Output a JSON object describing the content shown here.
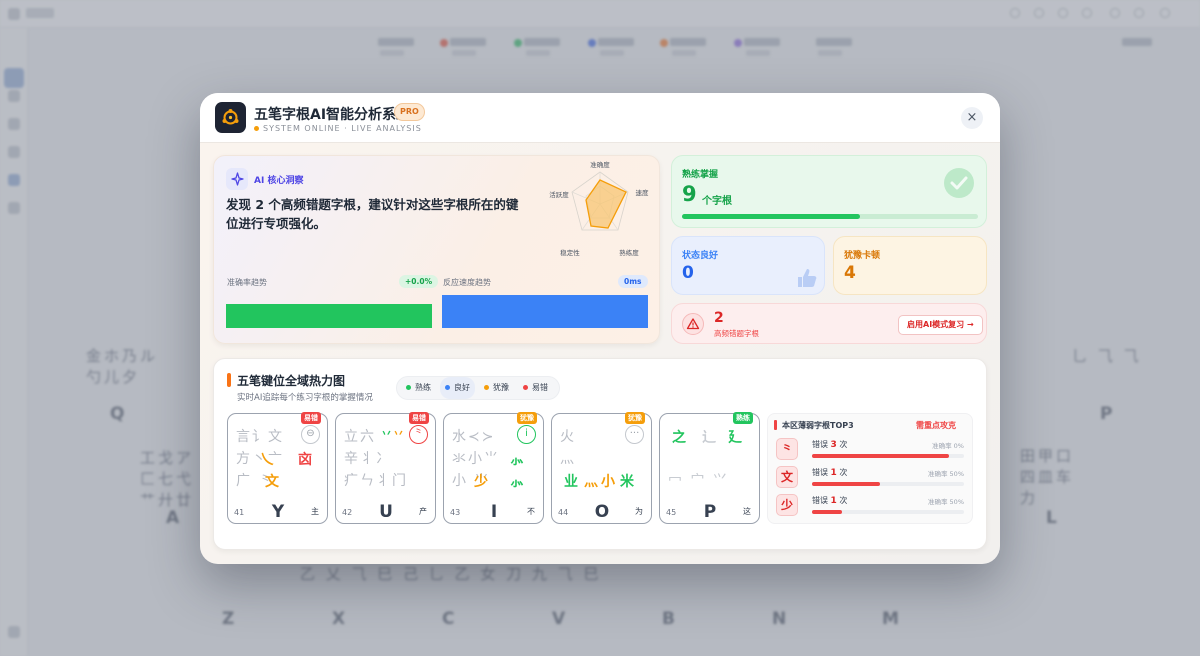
{
  "modal": {
    "title": "五笔字根AI智能分析系统",
    "badge": "PRO",
    "status": "SYSTEM ONLINE · LIVE ANALYSIS",
    "close_icon": "×"
  },
  "insight": {
    "label": "AI 核心洞察",
    "icon": "sparkle-icon",
    "text": "发现 2 个高频错题字根，建议针对这些字根所在的键位进行专项强化。",
    "radar_axes": [
      "准确度",
      "速度",
      "熟练度",
      "稳定性",
      "活跃度"
    ],
    "accuracy_trend_label": "准确率趋势",
    "accuracy_trend_value": "+0.0%",
    "speed_trend_label": "反应速度趋势",
    "speed_trend_value": "0ms"
  },
  "stats": {
    "mastered_label": "熟练掌握",
    "mastered_value": "9",
    "mastered_unit": "个字根",
    "mastered_progress": 0.6,
    "good_label": "状态良好",
    "good_value": "0",
    "hesitant_label": "犹豫卡顿",
    "hesitant_value": "4",
    "errors_value": "2",
    "errors_label": "高频错题字根",
    "review_button": "启用AI模式复习 →"
  },
  "heatmap": {
    "title": "五笔键位全域热力图",
    "subtitle": "实时AI追踪每个练习字根的掌握情况",
    "legend": [
      "熟练",
      "良好",
      "犹豫",
      "易错"
    ],
    "colors": {
      "mastered": "#22c55e",
      "good": "#3b82f6",
      "hesitant": "#f59e0b",
      "error": "#ef4444"
    },
    "keys": [
      {
        "num": "41",
        "letter": "Y",
        "word": "主",
        "status": "易错"
      },
      {
        "num": "42",
        "letter": "U",
        "word": "产",
        "status": "易错"
      },
      {
        "num": "43",
        "letter": "I",
        "word": "不",
        "status": "犹豫"
      },
      {
        "num": "44",
        "letter": "O",
        "word": "为",
        "status": "犹豫"
      },
      {
        "num": "45",
        "letter": "P",
        "word": "这",
        "status": "熟练"
      }
    ],
    "weak": {
      "title": "本区薄弱字根TOP3",
      "tag": "需重点攻克",
      "items": [
        {
          "root": "⺀",
          "err_prefix": "错误",
          "count": "3",
          "err_suffix": "次",
          "acc": "准确率 0%",
          "fill": 0.9
        },
        {
          "root": "文",
          "err_prefix": "错误",
          "count": "1",
          "err_suffix": "次",
          "acc": "准确率 50%",
          "fill": 0.45
        },
        {
          "root": "少",
          "err_prefix": "错误",
          "count": "1",
          "err_suffix": "次",
          "acc": "准确率 50%",
          "fill": 0.2
        }
      ]
    }
  },
  "background": {
    "keys_row1": [
      "Q",
      "P"
    ],
    "keys_row2": [
      "A",
      "L"
    ],
    "keys_row3": [
      "Z",
      "X",
      "C",
      "V",
      "B",
      "N",
      "M"
    ]
  }
}
